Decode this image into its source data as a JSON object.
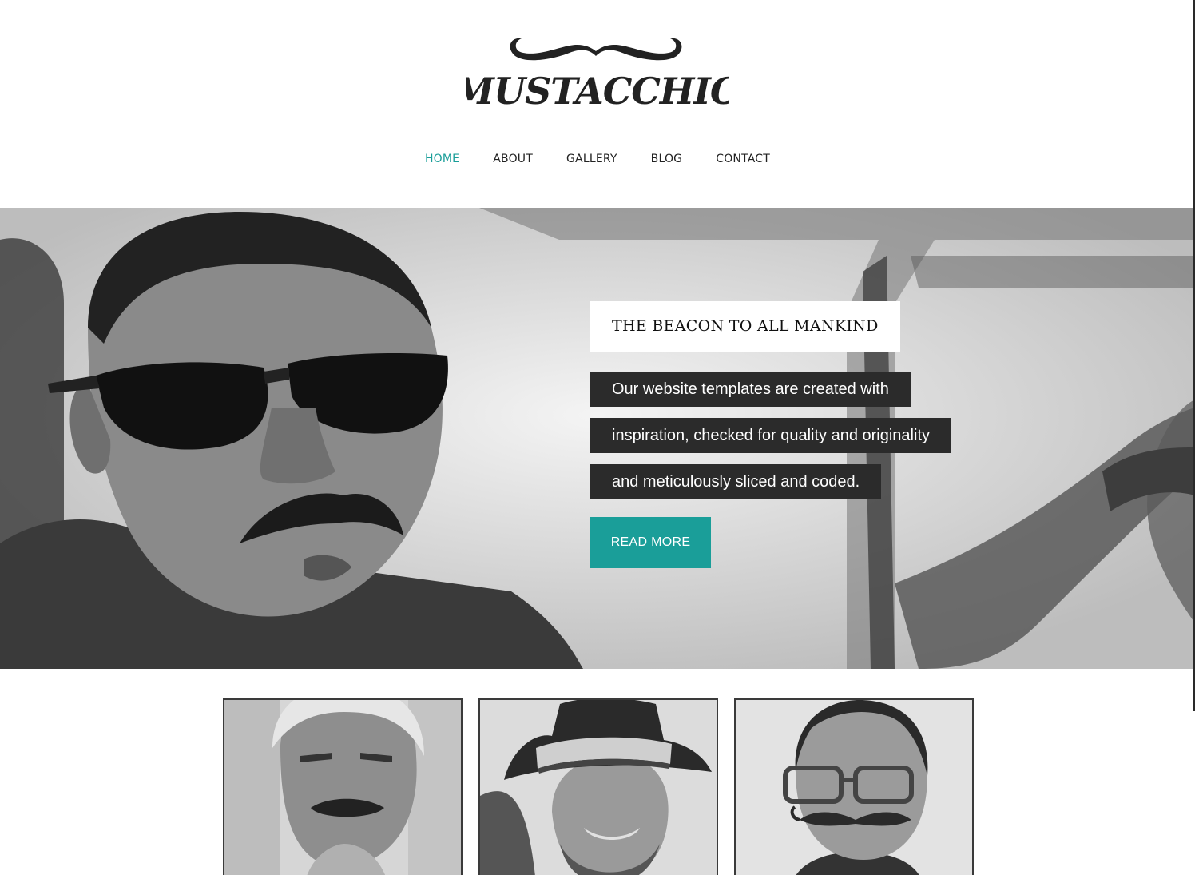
{
  "brand": {
    "logo_text": "MUSTACCHIO"
  },
  "nav": {
    "items": [
      {
        "label": "HOME",
        "active": true
      },
      {
        "label": "ABOUT",
        "active": false
      },
      {
        "label": "GALLERY",
        "active": false
      },
      {
        "label": "BLOG",
        "active": false
      },
      {
        "label": "CONTACT",
        "active": false
      }
    ]
  },
  "hero": {
    "title": "THE BEACON TO ALL MANKIND",
    "lines": [
      "Our website templates are created with",
      "inspiration, checked for quality and originality",
      "and meticulously sliced and coded."
    ],
    "button_label": "READ MORE"
  },
  "colors": {
    "accent": "#1a9e99",
    "text_dark": "#222222",
    "caption_bg": "#2b2b2b"
  },
  "portraits": [
    {
      "subject": "older man with mustache"
    },
    {
      "subject": "man in fedora hat"
    },
    {
      "subject": "man with glasses and curled mustache"
    }
  ]
}
